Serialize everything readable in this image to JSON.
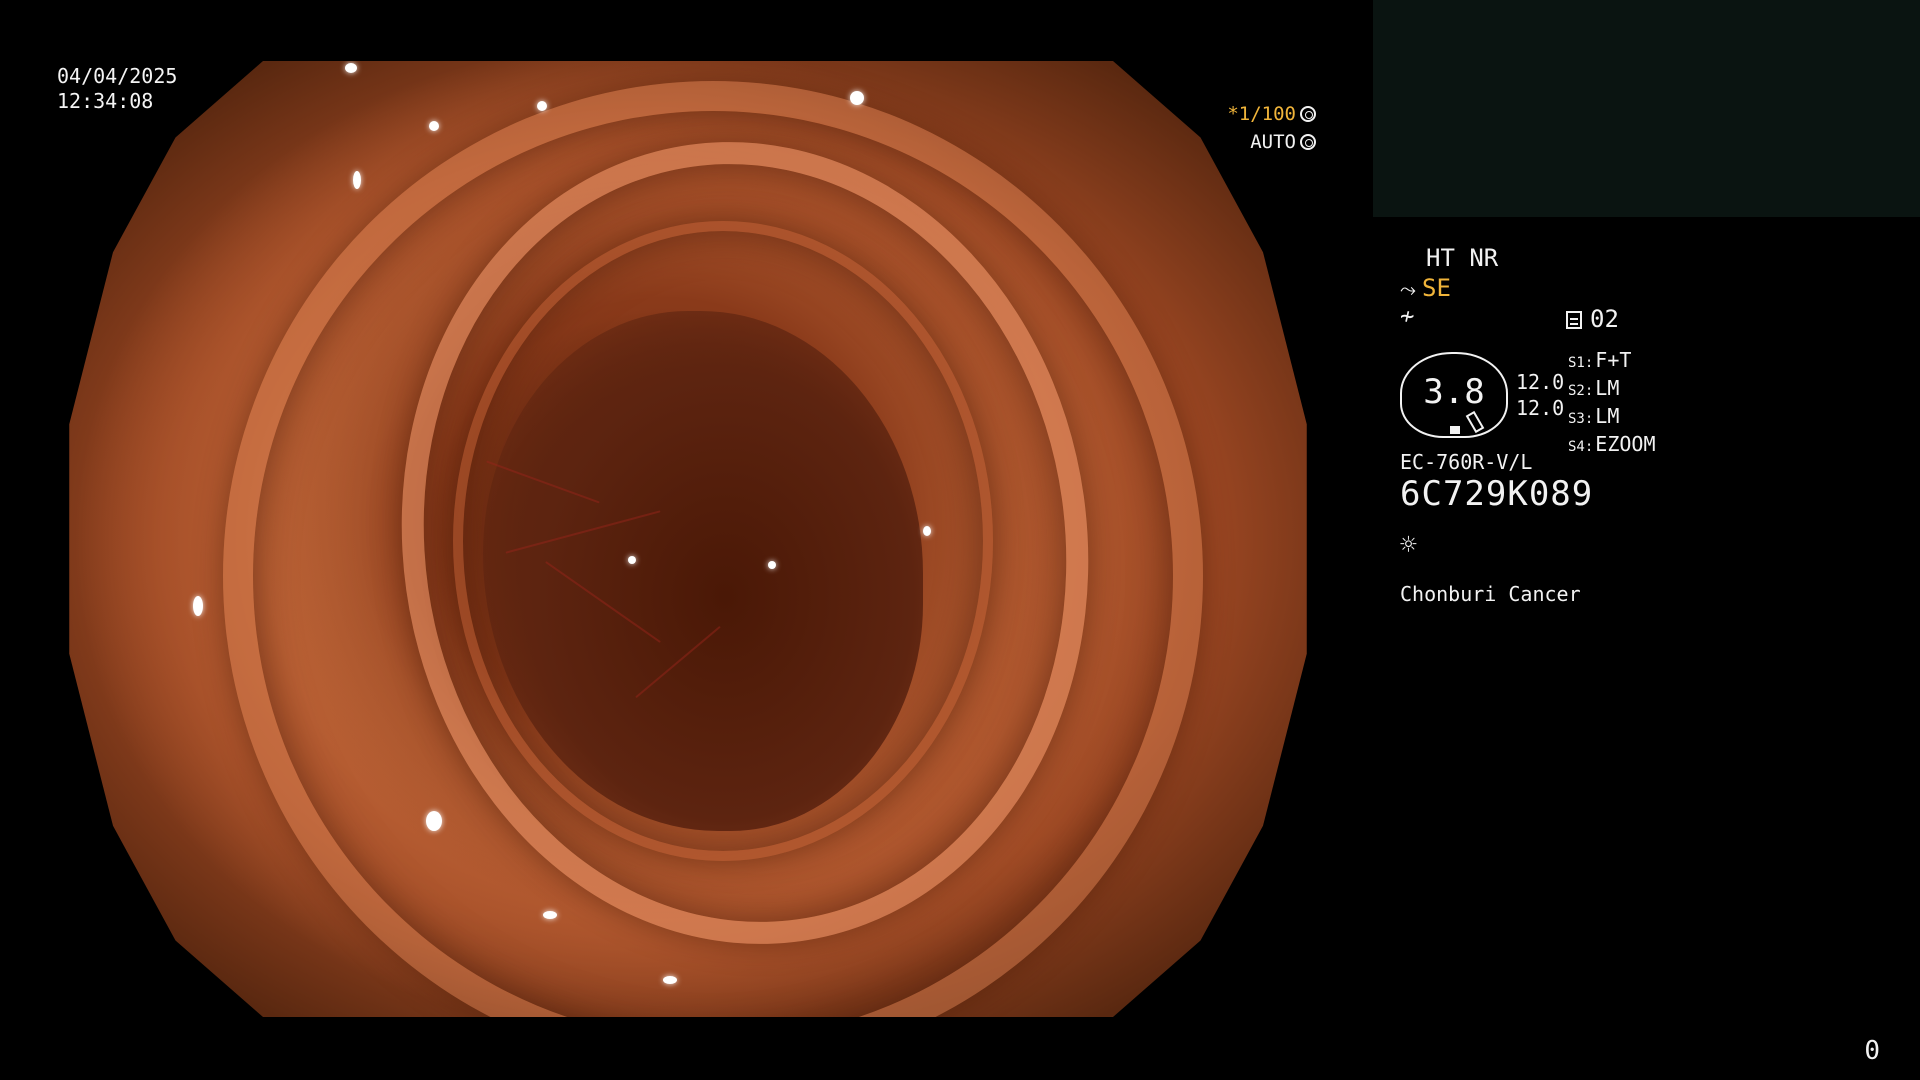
{
  "datetime": {
    "date": "04/04/2025",
    "time": "12:34:08"
  },
  "exposure": {
    "shutter": "*1/100",
    "mode": "AUTO",
    "shutter_icon": "aperture-icon",
    "mode_icon": "iris-icon"
  },
  "info": {
    "ht_nr": "HT NR",
    "se_label": "SE",
    "se_icon": "hose-icon",
    "signal_icon": "signal-icon",
    "preset_number": "02",
    "preset_icon": "preset-icon",
    "gauge": {
      "value": "3.8",
      "right_top": "12.0",
      "right_bottom": "12.0"
    },
    "switches": [
      {
        "key": "S1:",
        "value": "F+T"
      },
      {
        "key": "S2:",
        "value": "LM"
      },
      {
        "key": "S3:",
        "value": "LM"
      },
      {
        "key": "S4:",
        "value": "EZOOM"
      }
    ],
    "model": "EC-760R-V/L",
    "serial": "6C729K089",
    "light_icon": "light-source-icon",
    "site": "Chonburi Cancer"
  },
  "counter": "0",
  "colors": {
    "accent": "#f0b43a",
    "text": "#f2f2f2",
    "pip_background": "#0a1411"
  }
}
